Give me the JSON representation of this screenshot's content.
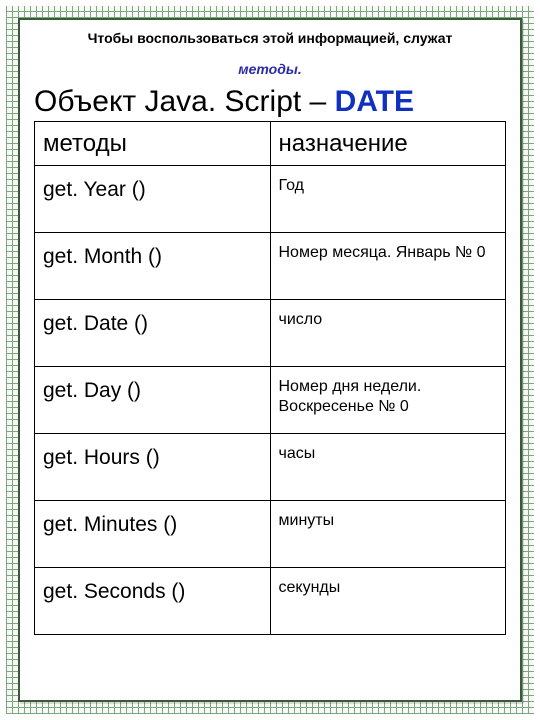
{
  "lead": "Чтобы воспользоваться этой информацией, служат",
  "lead_em": "методы.",
  "title_prefix": "Объект Java. Script – ",
  "title_date": "DATE",
  "headers": {
    "col1": "методы",
    "col2": "назначение"
  },
  "rows": [
    {
      "method": "get. Year ()",
      "desc": "Год"
    },
    {
      "method": "get. Month ()",
      "desc": "Номер месяца. Январь № 0"
    },
    {
      "method": "get. Date ()",
      "desc": "число"
    },
    {
      "method": "get. Day ()",
      "desc": "Номер дня недели. Воскресенье № 0"
    },
    {
      "method": "get. Hours ()",
      "desc": "часы"
    },
    {
      "method": "get. Minutes ()",
      "desc": "минуты"
    },
    {
      "method": "get. Seconds ()",
      "desc": "секунды"
    }
  ]
}
